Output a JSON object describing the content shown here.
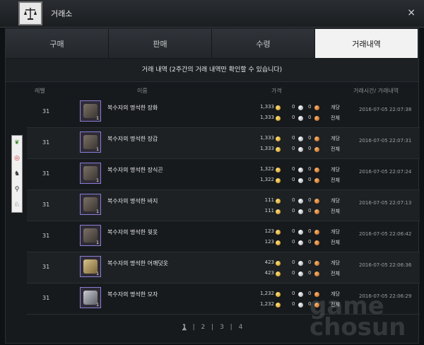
{
  "window": {
    "title": "거래소",
    "close_glyph": "×"
  },
  "tabs": [
    {
      "label": "구매",
      "active": false
    },
    {
      "label": "판매",
      "active": false
    },
    {
      "label": "수령",
      "active": false
    },
    {
      "label": "거래내역",
      "active": true
    }
  ],
  "notice": "거래 내역 (2주간의 거래 내역만 확인할 수 있습니다)",
  "columns": {
    "level": "레벨",
    "name": "이름",
    "price": "가격",
    "time": "거래시간/ 거래내역"
  },
  "unit_label": "개당",
  "total_label": "전체",
  "zero": "0",
  "rows": [
    {
      "level": "31",
      "name": "복수자의 명석한 장화",
      "qty": "1",
      "unit_price": "1,333",
      "total_price": "1,333",
      "time": "2016-07-05 22:07:38"
    },
    {
      "level": "31",
      "name": "복수자의 명석한 장갑",
      "qty": "1",
      "unit_price": "1,333",
      "total_price": "1,333",
      "time": "2016-07-05 22:07:31"
    },
    {
      "level": "31",
      "name": "복수자의 명석한 장식끈",
      "qty": "1",
      "unit_price": "1,322",
      "total_price": "1,322",
      "time": "2016-07-05 22:07:24"
    },
    {
      "level": "31",
      "name": "복수자의 명석한 바지",
      "qty": "1",
      "unit_price": "111",
      "total_price": "111",
      "time": "2016-07-05 22:07:13"
    },
    {
      "level": "31",
      "name": "복수자의 명석한 윗옷",
      "qty": "1",
      "unit_price": "123",
      "total_price": "123",
      "time": "2016-07-05 22:06:42"
    },
    {
      "level": "31",
      "name": "복수자의 명석한 어깨덧옷",
      "qty": "1",
      "unit_price": "423",
      "total_price": "423",
      "time": "2016-07-05 22:06:36"
    },
    {
      "level": "31",
      "name": "복수자의 명석한 모자",
      "qty": "1",
      "unit_price": "1,232",
      "total_price": "1,232",
      "time": "2016-07-05 22:06:29"
    }
  ],
  "pagination": {
    "pages": [
      "1",
      "2",
      "3",
      "4"
    ],
    "current": "1"
  },
  "sidebar_icons": [
    "leaf-icon",
    "lifebuoy-icon",
    "horse-icon",
    "search-icon",
    "mount-icon"
  ],
  "watermark": "game chosun",
  "colors": {
    "tab_active_bg": "#f2f2f2",
    "item_border": "#8a7dd6",
    "gold": "#e0a93a"
  }
}
